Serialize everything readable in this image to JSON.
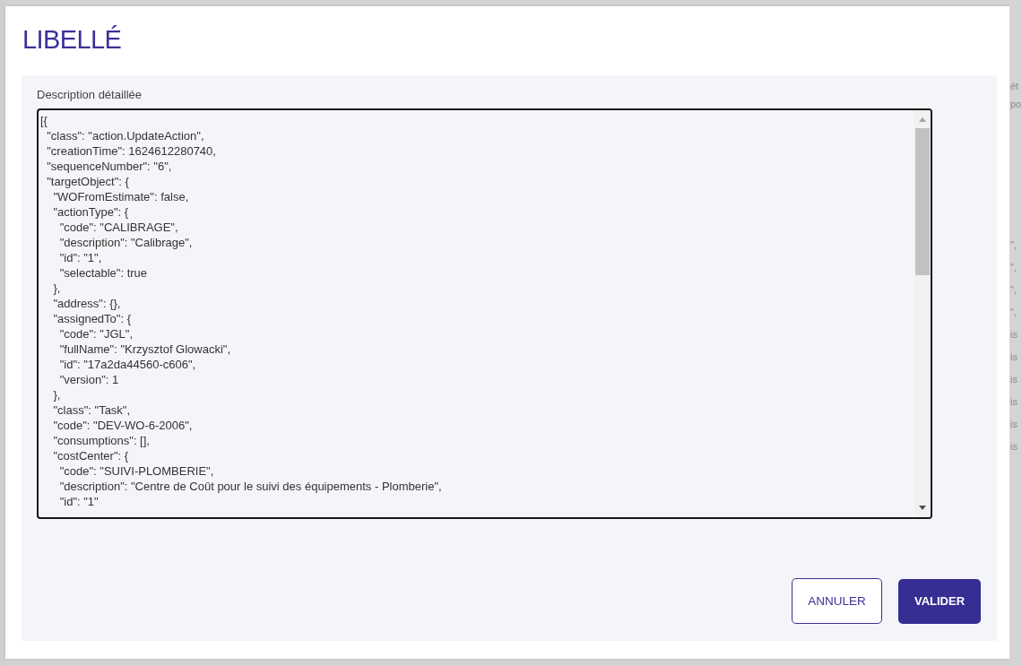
{
  "backdrop": {
    "header_fragments": [
      "ét",
      "po"
    ],
    "row_fragments": [
      "\",",
      "\",",
      "\",",
      "\",",
      "is",
      "is",
      "is",
      "is",
      "is",
      "is"
    ]
  },
  "dialog": {
    "title": "LIBELLÉ",
    "field": {
      "label": "Description détaillée",
      "value": "[{\n  \"class\": \"action.UpdateAction\",\n  \"creationTime\": 1624612280740,\n  \"sequenceNumber\": \"6\",\n  \"targetObject\": {\n    \"WOFromEstimate\": false,\n    \"actionType\": {\n      \"code\": \"CALIBRAGE\",\n      \"description\": \"Calibrage\",\n      \"id\": \"1\",\n      \"selectable\": true\n    },\n    \"address\": {},\n    \"assignedTo\": {\n      \"code\": \"JGL\",\n      \"fullName\": \"Krzysztof Glowacki\",\n      \"id\": \"17a2da44560-c606\",\n      \"version\": 1\n    },\n    \"class\": \"Task\",\n    \"code\": \"DEV-WO-6-2006\",\n    \"consumptions\": [],\n    \"costCenter\": {\n      \"code\": \"SUIVI-PLOMBERIE\",\n      \"description\": \"Centre de Coût pour le suivi des équipements - Plomberie\",\n      \"id\": \"1\""
    },
    "buttons": [
      {
        "label": "ANNULER",
        "kind": "secondary"
      },
      {
        "label": "VALIDER",
        "kind": "primary"
      }
    ]
  }
}
